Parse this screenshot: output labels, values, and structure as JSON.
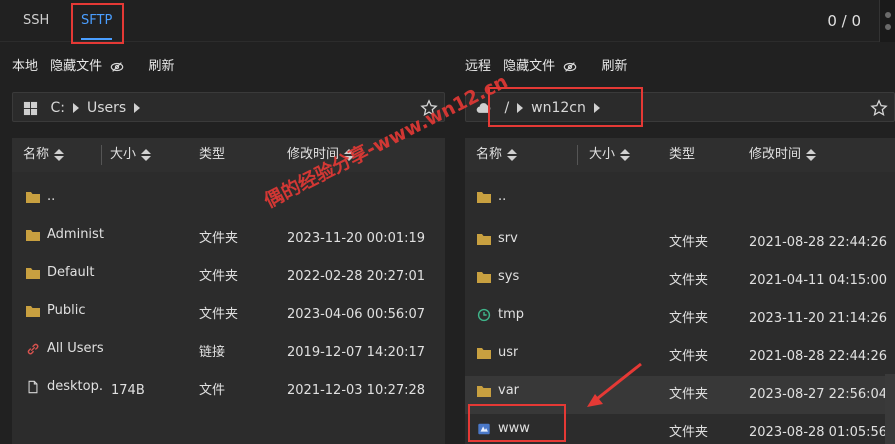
{
  "tabs": {
    "ssh": "SSH",
    "sftp": "SFTP"
  },
  "counter": "0 / 0",
  "local": {
    "title": "本地",
    "hide_files": "隐藏文件",
    "refresh": "刷新",
    "path": [
      "C:",
      "Users"
    ],
    "columns": {
      "name": "名称",
      "size": "大小",
      "type": "类型",
      "mtime": "修改时间"
    },
    "rows": [
      {
        "name": "..",
        "size": "",
        "type": "",
        "mtime": "",
        "icon": "folder-icon"
      },
      {
        "name": "Administ",
        "size": "",
        "type": "文件夹",
        "mtime": "2023-11-20 00:01:19",
        "icon": "folder-icon"
      },
      {
        "name": "Default",
        "size": "",
        "type": "文件夹",
        "mtime": "2022-02-28 20:27:01",
        "icon": "folder-icon"
      },
      {
        "name": "Public",
        "size": "",
        "type": "文件夹",
        "mtime": "2023-04-06 00:56:07",
        "icon": "folder-icon"
      },
      {
        "name": "All Users",
        "size": "",
        "type": "链接",
        "mtime": "2019-12-07 14:20:17",
        "icon": "link-icon"
      },
      {
        "name": "desktop.",
        "size": "174B",
        "type": "文件",
        "mtime": "2021-12-03 10:27:28",
        "icon": "file-icon"
      }
    ]
  },
  "remote": {
    "title": "远程",
    "hide_files": "隐藏文件",
    "refresh": "刷新",
    "path": [
      "/",
      "wn12cn"
    ],
    "columns": {
      "name": "名称",
      "size": "大小",
      "type": "类型",
      "mtime": "修改时间"
    },
    "rows": [
      {
        "name": "..",
        "size": "",
        "type": "",
        "mtime": "",
        "icon": "folder-icon"
      },
      {
        "name": "srv",
        "size": "",
        "type": "文件夹",
        "mtime": "2021-08-28 22:44:26",
        "icon": "folder-icon"
      },
      {
        "name": "sys",
        "size": "",
        "type": "文件夹",
        "mtime": "2021-04-11 04:15:00",
        "icon": "folder-icon"
      },
      {
        "name": "tmp",
        "size": "",
        "type": "文件夹",
        "mtime": "2023-11-20 21:14:26",
        "icon": "clock-folder-icon"
      },
      {
        "name": "usr",
        "size": "",
        "type": "文件夹",
        "mtime": "2021-08-28 22:44:26",
        "icon": "folder-icon"
      },
      {
        "name": "var",
        "size": "",
        "type": "文件夹",
        "mtime": "2023-08-27 22:56:04",
        "icon": "folder-icon"
      },
      {
        "name": "www",
        "size": "",
        "type": "文件夹",
        "mtime": "2023-08-28 01:05:56",
        "icon": "special-folder-icon"
      }
    ]
  },
  "watermark": "偶的经验分享-www.wn12.cn",
  "colors": {
    "accent": "#4a9eff",
    "highlight": "#e53935",
    "folder": "#c8a040"
  }
}
